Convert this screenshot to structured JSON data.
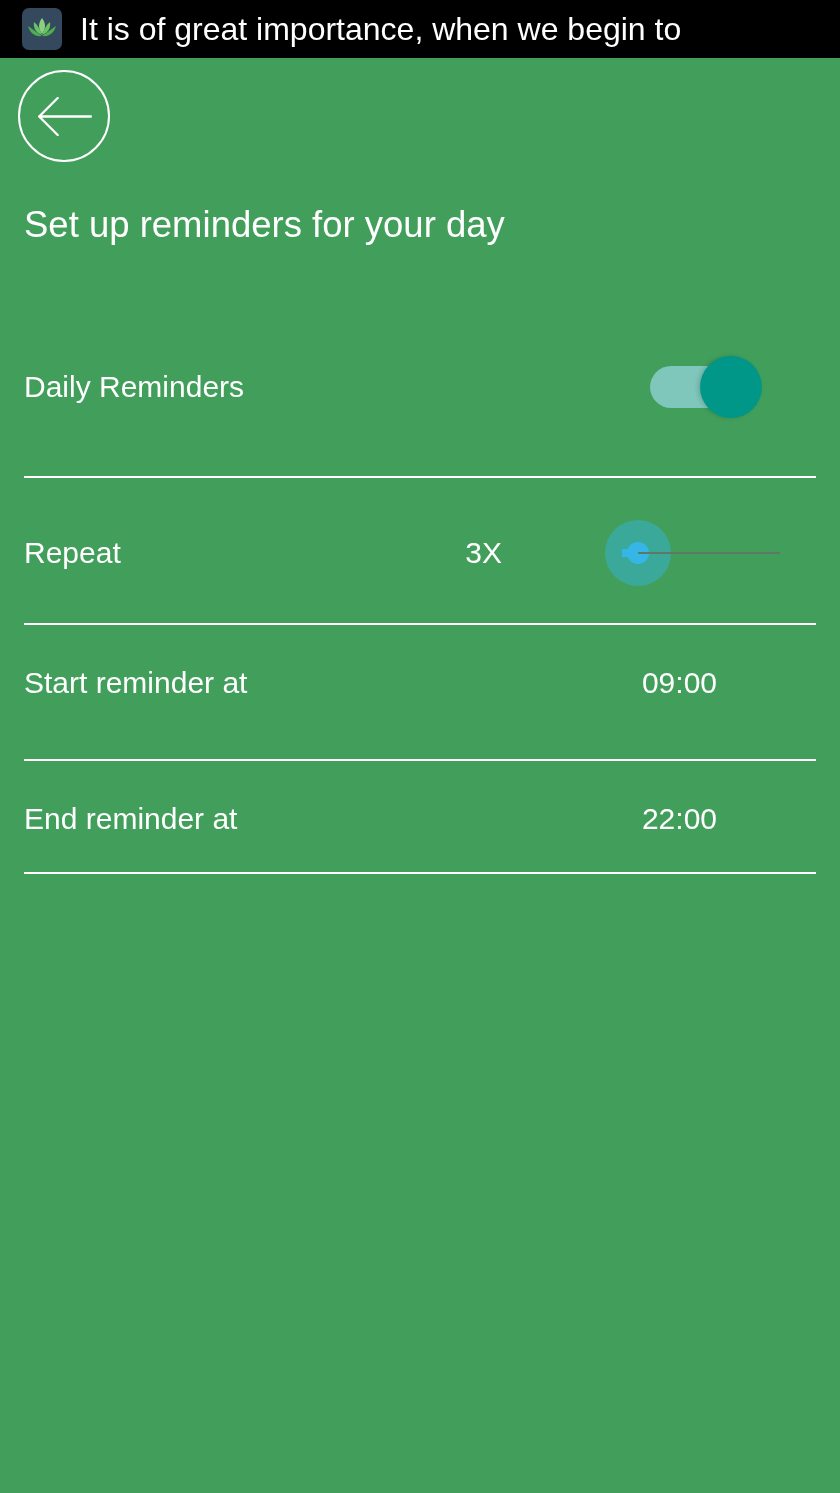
{
  "status_bar": {
    "notification_text": "It is of great importance, when we begin to"
  },
  "header": {
    "title": "Set up reminders for your day"
  },
  "settings": [
    {
      "kind": "toggle",
      "label": "Daily Reminders",
      "on": true
    },
    {
      "kind": "slider",
      "label": "Repeat",
      "value": "3X",
      "level": 0.1
    },
    {
      "kind": "time",
      "label": "Start reminder at",
      "value": "09:00"
    },
    {
      "kind": "time",
      "label": "End reminder at",
      "value": "22:00"
    }
  ]
}
